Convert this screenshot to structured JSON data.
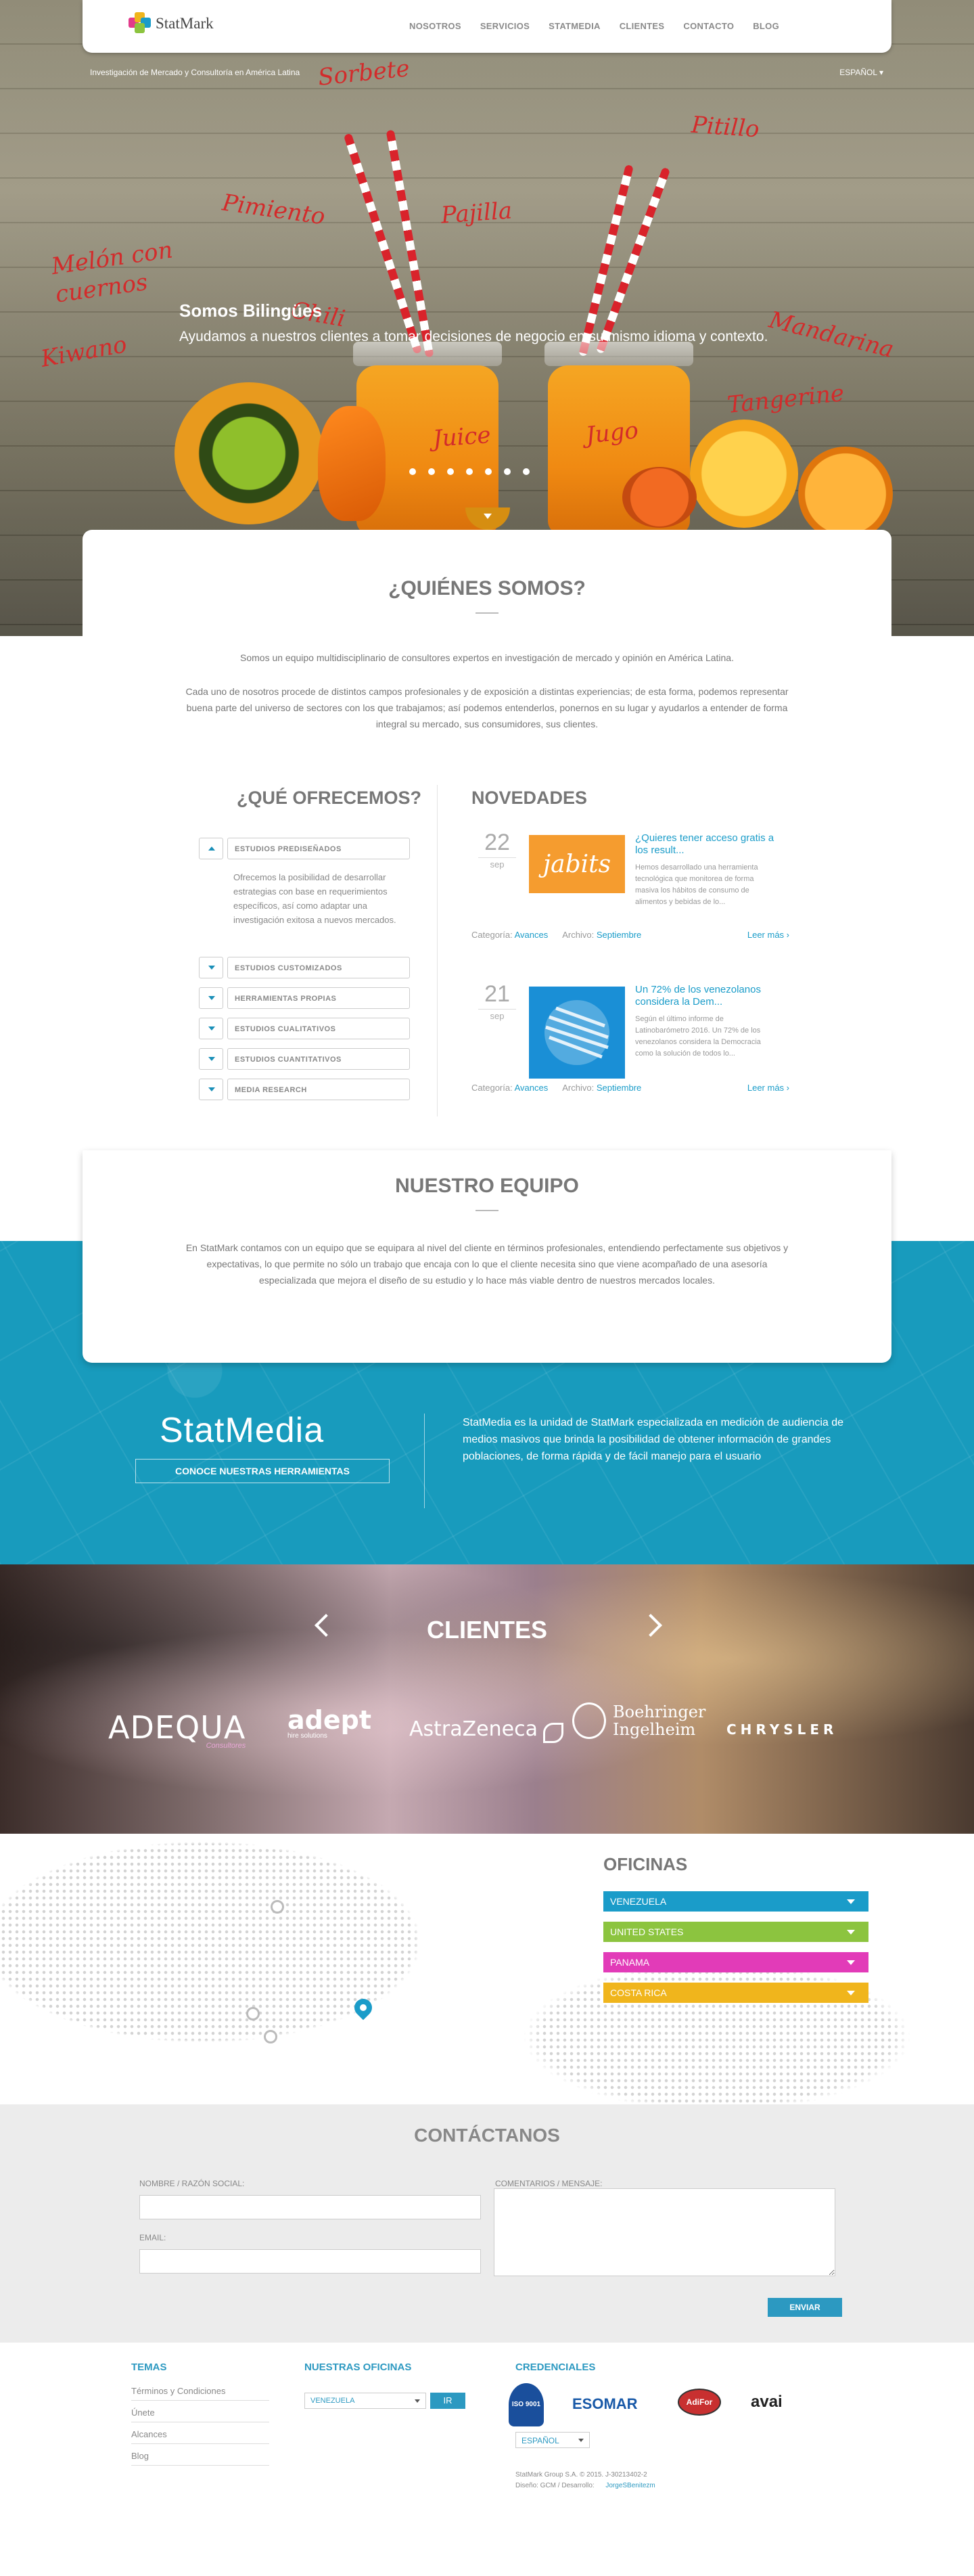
{
  "nav": {
    "brand": "StatMark",
    "links": [
      "NOSOTROS",
      "SERVICIOS",
      "STATMEDIA",
      "CLIENTES",
      "CONTACTO",
      "BLOG"
    ]
  },
  "hero": {
    "tagline": "Investigación de Mercado y Consultoría en América Latina",
    "language": "ESPAÑOL",
    "title": "Somos Bilingües",
    "subtitle": "Ayudamos a nuestros clientes a tomar decisiones de negocio en su mismo idioma y contexto.",
    "labels": [
      "Sorbete",
      "Pitillo",
      "Pimiento",
      "Pajilla",
      "Melón con cuernos",
      "Chili",
      "Kiwano",
      "Mandarina",
      "Tangerine",
      "Juice",
      "Jugo"
    ],
    "slides": 7
  },
  "who": {
    "title": "¿QUIÉNES SOMOS?",
    "p1": "Somos un equipo multidisciplinario de consultores expertos en investigación de mercado y opinión en América Latina.",
    "p2": "Cada uno de nosotros procede de distintos campos profesionales y de exposición a distintas experiencias; de esta forma, podemos representar buena parte del universo de sectores con los que trabajamos; así podemos entenderlos, ponernos en su lugar y ayudarlos a entender de forma integral su mercado, sus consumidores, sus clientes."
  },
  "offer": {
    "title": "¿QUÉ OFRECEMOS?",
    "items": [
      "ESTUDIOS PREDISEÑADOS",
      "ESTUDIOS CUSTOMIZADOS",
      "HERRAMIENTAS PROPIAS",
      "ESTUDIOS CUALITATIVOS",
      "ESTUDIOS CUANTITATIVOS",
      "MEDIA RESEARCH"
    ],
    "expanded_text": "Ofrecemos la posibilidad de desarrollar estrategias con base en requerimientos específicos, así como adaptar una investigación exitosa a nuevos mercados."
  },
  "news": {
    "title": "NOVEDADES",
    "category_label": "Categoría:",
    "archive_label": "Archivo:",
    "more_label": "Leer más ›",
    "items": [
      {
        "day": "22",
        "month": "sep",
        "headline": "¿Quieres tener acceso gratis a los result...",
        "excerpt": "Hemos desarrollado una herramienta tecnológica que monitorea de forma masiva los hábitos de consumo de alimentos y bebidas de lo...",
        "image_text": "jabits",
        "category": "Avances",
        "archive": "Septiembre"
      },
      {
        "day": "21",
        "month": "sep",
        "headline": "Un 72% de los venezolanos considera la Dem...",
        "excerpt": "Según el último informe de Latinobarómetro 2016. Un 72% de los venezolanos considera la Democracia como la solución de todos lo...",
        "category": "Avances",
        "archive": "Septiembre"
      }
    ]
  },
  "team": {
    "title": "NUESTRO EQUIPO",
    "text": "En StatMark contamos con un equipo que se equipara al nivel del cliente en términos profesionales, entendiendo perfectamente sus objetivos y expectativas, lo que permite no sólo un trabajo que encaja con lo que el cliente necesita sino que viene acompañado de una asesoría especializada que mejora el diseño de su estudio y lo hace más viable dentro de nuestros mercados locales."
  },
  "statmedia": {
    "logo": "StatMedia",
    "button": "CONOCE NUESTRAS HERRAMIENTAS",
    "text": "StatMedia es la unidad de StatMark especializada en medición de audiencia de medios masivos que brinda la posibilidad de obtener información de grandes poblaciones, de forma rápida y de fácil manejo para el usuario"
  },
  "clients": {
    "title": "CLIENTES",
    "logos": [
      "ADEQUA",
      "adept",
      "AstraZeneca",
      "Boehringer Ingelheim",
      "CHRYSLER"
    ],
    "adequa_sub": "Consultores",
    "adept_sub": "hire solutions"
  },
  "offices": {
    "title": "OFICINAS",
    "items": [
      {
        "name": "VENEZUELA",
        "color": "#1a9cc9"
      },
      {
        "name": "UNITED STATES",
        "color": "#8cc43f"
      },
      {
        "name": "PANAMA",
        "color": "#e23bb8"
      },
      {
        "name": "COSTA RICA",
        "color": "#f0b51c"
      }
    ]
  },
  "contact": {
    "title": "CONTÁCTANOS",
    "name_label": "NOMBRE / RAZÓN SOCIAL:",
    "email_label": "EMAIL:",
    "message_label": "COMENTARIOS / MENSAJE:",
    "submit": "ENVIAR"
  },
  "footer": {
    "col1_title": "TEMAS",
    "links": [
      "Términos y Condiciones",
      "Únete",
      "Alcances",
      "Blog"
    ],
    "col2_title": "NUESTRAS OFICINAS",
    "office_select": "VENEZUELA",
    "go": "IR",
    "col3_title": "CREDENCIALES",
    "credentials": [
      "ISO 9001",
      "ESOMAR",
      "AdiFor",
      "avai"
    ],
    "language": "ESPAÑOL",
    "copyright": "StatMark Group S.A. © 2015. J-30213402-2",
    "design_label": "Diseño: GCM / Desarrollo:",
    "developer": "JorgeSBenitezm"
  }
}
